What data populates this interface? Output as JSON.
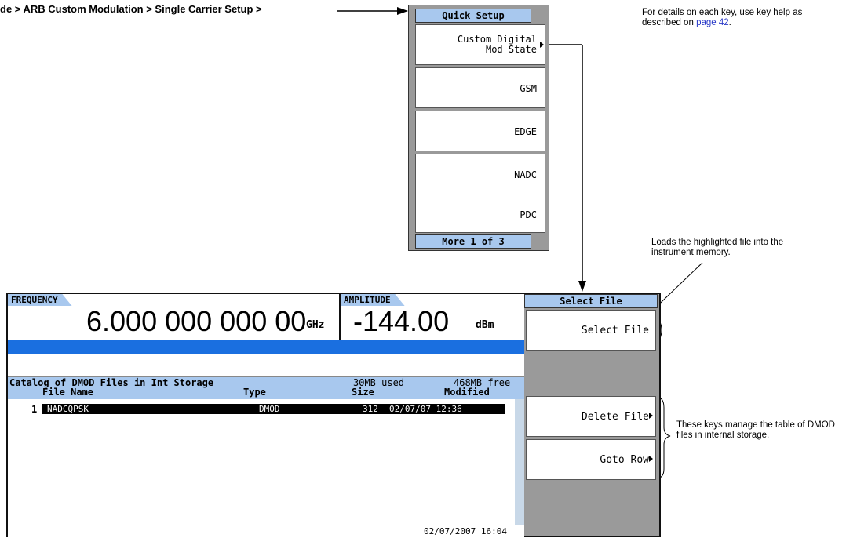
{
  "breadcrumb": "de > ARB Custom Modulation > Single Carrier Setup >",
  "quick_setup": {
    "title": "Quick Setup",
    "keys": [
      {
        "line1": "Custom Digital",
        "line2": "Mod State"
      },
      {
        "line1": "GSM"
      },
      {
        "line1": "EDGE"
      },
      {
        "line1": "NADC"
      },
      {
        "line1": "PDC"
      }
    ],
    "more": "More 1 of 3"
  },
  "notes": {
    "top_right_text": "For details on each key, use key help as described on",
    "top_right_link": "page 42",
    "top_right_end": ".",
    "select_file_note": "Loads the highlighted file into the instrument memory.",
    "manage_note": "These keys manage the table of DMOD files in internal storage."
  },
  "screen": {
    "frequency_label": "FREQUENCY",
    "frequency_value": "6.000 000 000 00",
    "frequency_unit": "GHz",
    "amplitude_label": "AMPLITUDE",
    "amplitude_value": "-144.00",
    "amplitude_unit": "dBm",
    "catalog_title": "Catalog of DMOD Files in Int Storage",
    "used": "30MB used",
    "free": "468MB free",
    "columns": {
      "name": "File Name",
      "type": "Type",
      "size": "Size",
      "modified": "Modified"
    },
    "rows": [
      {
        "index": "1",
        "name": "NADCQPSK",
        "type": "DMOD",
        "size": "312",
        "modified": "02/07/07 12:36"
      }
    ],
    "timestamp": "02/07/2007 16:04"
  },
  "softkeys": {
    "title": "Select File",
    "select_file": "Select File",
    "delete_file": "Delete File",
    "goto_row": "Goto Row"
  },
  "colors": {
    "softkey_title": "#a8c8ee",
    "status_bar": "#1a6fe0",
    "panel_gray": "#9a9a9a"
  }
}
